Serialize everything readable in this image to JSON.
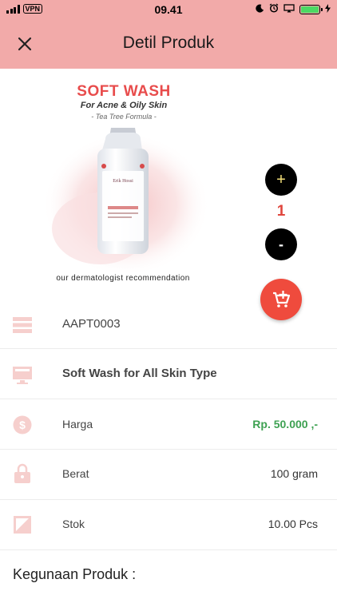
{
  "status_bar": {
    "vpn": "VPN",
    "time": "09.41"
  },
  "header": {
    "title": "Detil Produk"
  },
  "product_image": {
    "title": "SOFT WASH",
    "subtitle": "For Acne & Oily Skin",
    "formula": "- Tea Tree Formula -",
    "caption": "our dermatologist recommendation"
  },
  "stepper": {
    "plus_label": "+",
    "quantity": "1",
    "minus_label": "-"
  },
  "rows": {
    "code": "AAPT0003",
    "name": "Soft Wash for All Skin Type",
    "price_label": "Harga",
    "price_value": "Rp. 50.000 ,-",
    "weight_label": "Berat",
    "weight_value": "100 gram",
    "stock_label": "Stok",
    "stock_value": "10.00 Pcs"
  },
  "section": {
    "title": "Kegunaan Produk :"
  },
  "colors": {
    "header_bg": "#f2aaa9",
    "accent_red": "#e44d45",
    "price_green": "#3ea152",
    "cart_button": "#ef4b3d",
    "icon_tint": "#f6cfcd"
  },
  "icons": [
    "close-icon",
    "cart-add-icon",
    "list-icon",
    "monitor-icon",
    "dollar-icon",
    "lock-icon",
    "image-icon"
  ]
}
